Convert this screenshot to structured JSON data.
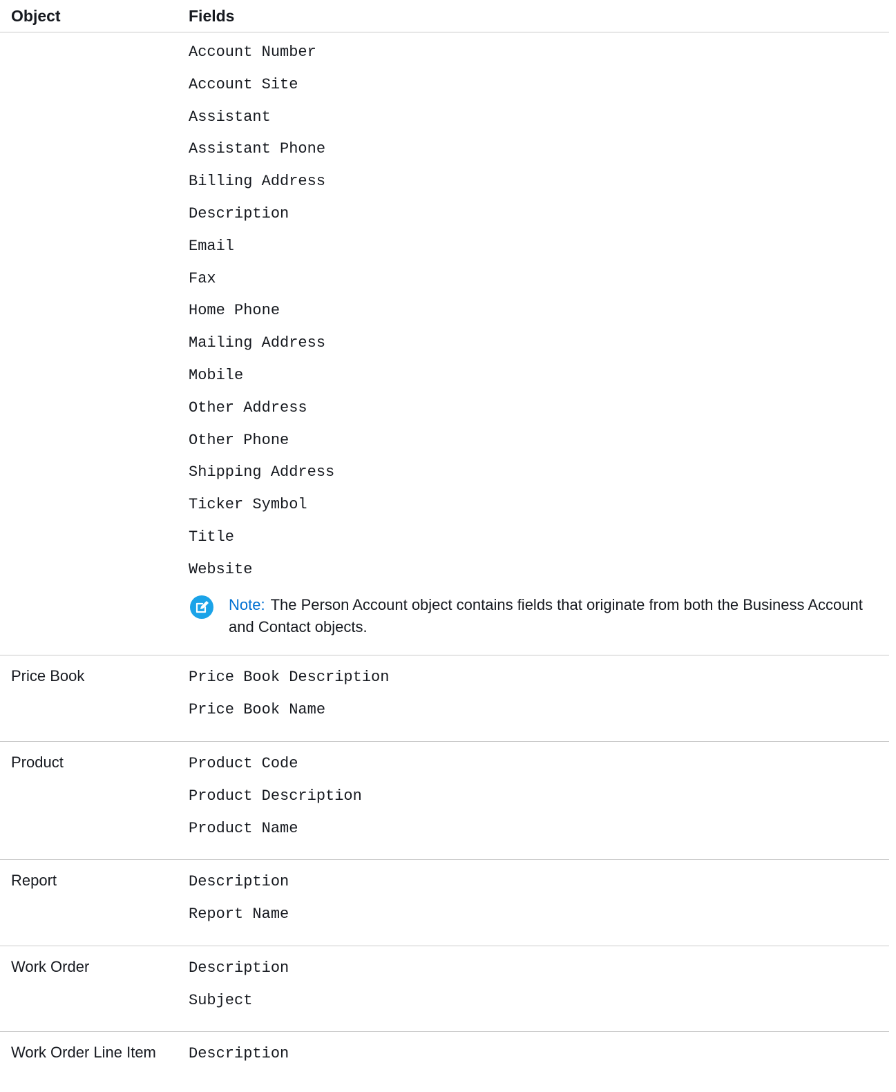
{
  "table": {
    "headers": {
      "object": "Object",
      "fields": "Fields"
    },
    "rows": [
      {
        "object": "",
        "fields": [
          "Account Number",
          "Account Site",
          "Assistant",
          "Assistant Phone",
          "Billing Address",
          "Description",
          "Email",
          "Fax",
          "Home Phone",
          "Mailing Address",
          "Mobile",
          "Other Address",
          "Other Phone",
          "Shipping Address",
          "Ticker Symbol",
          "Title",
          "Website"
        ],
        "note": {
          "label": "Note:",
          "text": "The Person Account object contains fields that originate from both the Business Account and Contact objects."
        }
      },
      {
        "object": "Price Book",
        "fields": [
          "Price Book Description",
          "Price Book Name"
        ]
      },
      {
        "object": "Product",
        "fields": [
          "Product Code",
          "Product Description",
          "Product Name"
        ]
      },
      {
        "object": "Report",
        "fields": [
          "Description",
          "Report Name"
        ]
      },
      {
        "object": "Work Order",
        "fields": [
          "Description",
          "Subject"
        ]
      },
      {
        "object": "Work Order Line Item",
        "fields": [
          "Description"
        ]
      }
    ]
  },
  "colors": {
    "note_accent": "#0070d2",
    "divider": "#c9c9c9"
  },
  "icons": {
    "note": "edit-note-icon"
  }
}
